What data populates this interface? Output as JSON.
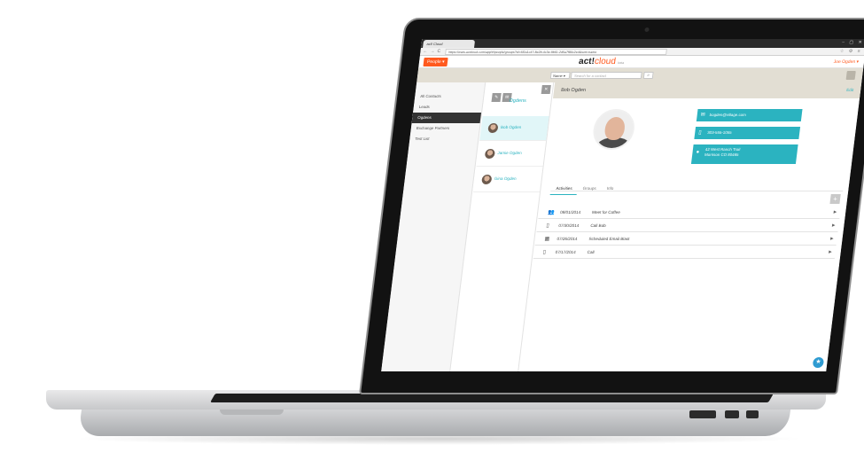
{
  "browser": {
    "tab_title": "act! Cloud",
    "window_controls": "– ▢ ✕",
    "url": "https://www.actcloud.com/app/#/people/groups?id=6f2a1c47-8e2b-4c3e-9b61-2d5a7f80c2e4&sort=name",
    "nav_back": "←",
    "nav_forward": "→",
    "nav_reload": "C",
    "toolbar_icons": "☆ ⚙ ≡"
  },
  "header": {
    "people_button": "People ▾",
    "brand_main": "act!",
    "brand_cloud": "cloud",
    "brand_beta": "beta",
    "username": "Joe Ogden ▾"
  },
  "search": {
    "select_value": "Name ▾",
    "placeholder": "Search for a contact",
    "button_icon": "⌕"
  },
  "sidebar": {
    "items": [
      {
        "label": "All Contacts"
      },
      {
        "label": "Leads"
      },
      {
        "label": "Ogdens"
      },
      {
        "label": "Exchange Partners"
      },
      {
        "label": "Test List"
      }
    ]
  },
  "group": {
    "title": "Ogdens",
    "contacts": [
      {
        "name": "Bob Ogden"
      },
      {
        "name": "Jamie Ogden"
      },
      {
        "name": "Gina Ogden"
      }
    ]
  },
  "detail": {
    "name": "Bob Ogden",
    "edit_label": "Edit",
    "email": "bogden@village.com",
    "phone": "303-555-1055",
    "address_line1": "42 West Ranch Trail",
    "address_line2": "Morrison CO 80465",
    "tabs": [
      "Activities",
      "Groups",
      "Info"
    ],
    "add_icon": "+",
    "activities": [
      {
        "date": "08/01/2014",
        "title": "Meet for Coffee",
        "icon": "people-icon"
      },
      {
        "date": "07/30/2014",
        "title": "Call Bob",
        "icon": "phone-icon"
      },
      {
        "date": "07/26/2014",
        "title": "Scheduled Email Blast",
        "icon": "calendar-icon"
      },
      {
        "date": "07/17/2014",
        "title": "Call",
        "icon": "phone-icon"
      }
    ]
  },
  "colors": {
    "accent_orange": "#ff5a1f",
    "accent_teal": "#2bb3c0",
    "header_band": "#e2ded3"
  }
}
